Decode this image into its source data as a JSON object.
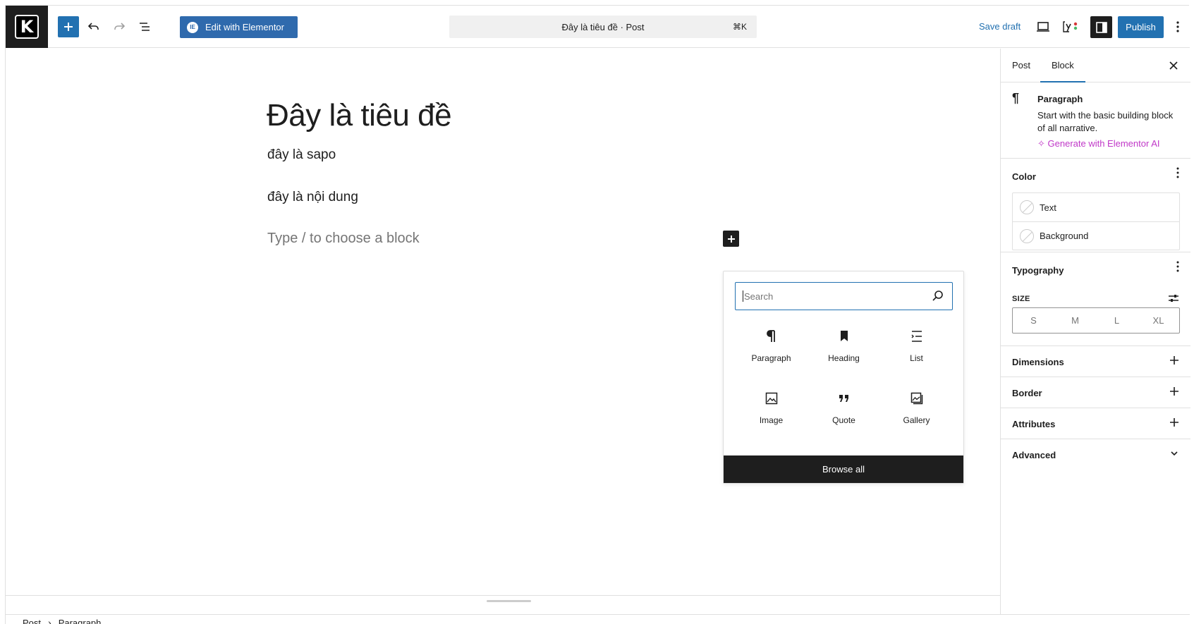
{
  "toolbar": {
    "logo_letter": "K",
    "edit_elementor_label": "Edit with Elementor",
    "command_title": "Đây là tiêu đề · Post",
    "command_shortcut": "⌘K",
    "save_draft_label": "Save draft",
    "publish_label": "Publish"
  },
  "editor": {
    "title": "Đây là tiêu đề",
    "paragraphs": [
      "đây là sapo",
      "đây là nội dung"
    ],
    "placeholder": "Type / to choose a block"
  },
  "inserter": {
    "search_placeholder": "Search",
    "blocks": [
      {
        "label": "Paragraph",
        "icon": "paragraph-icon"
      },
      {
        "label": "Heading",
        "icon": "bookmark-icon"
      },
      {
        "label": "List",
        "icon": "list-icon"
      },
      {
        "label": "Image",
        "icon": "image-icon"
      },
      {
        "label": "Quote",
        "icon": "quote-icon"
      },
      {
        "label": "Gallery",
        "icon": "gallery-icon"
      }
    ],
    "browse_all_label": "Browse all"
  },
  "sidebar": {
    "tabs": [
      "Post",
      "Block"
    ],
    "active_tab": "Block",
    "block_card": {
      "title": "Paragraph",
      "description": "Start with the basic building block of all narrative.",
      "ai_link": "Generate with Elementor AI"
    },
    "color": {
      "title": "Color",
      "items": [
        "Text",
        "Background"
      ]
    },
    "typography": {
      "title": "Typography",
      "size_label": "SIZE",
      "sizes": [
        "S",
        "M",
        "L",
        "XL"
      ]
    },
    "panels": [
      "Dimensions",
      "Border",
      "Attributes",
      "Advanced"
    ]
  },
  "breadcrumb": [
    "Post",
    "Paragraph"
  ],
  "colors": {
    "accent": "#2271b1",
    "elementor": "#2f6aad",
    "ai": "#c038c8",
    "dark": "#1e1e1e"
  }
}
